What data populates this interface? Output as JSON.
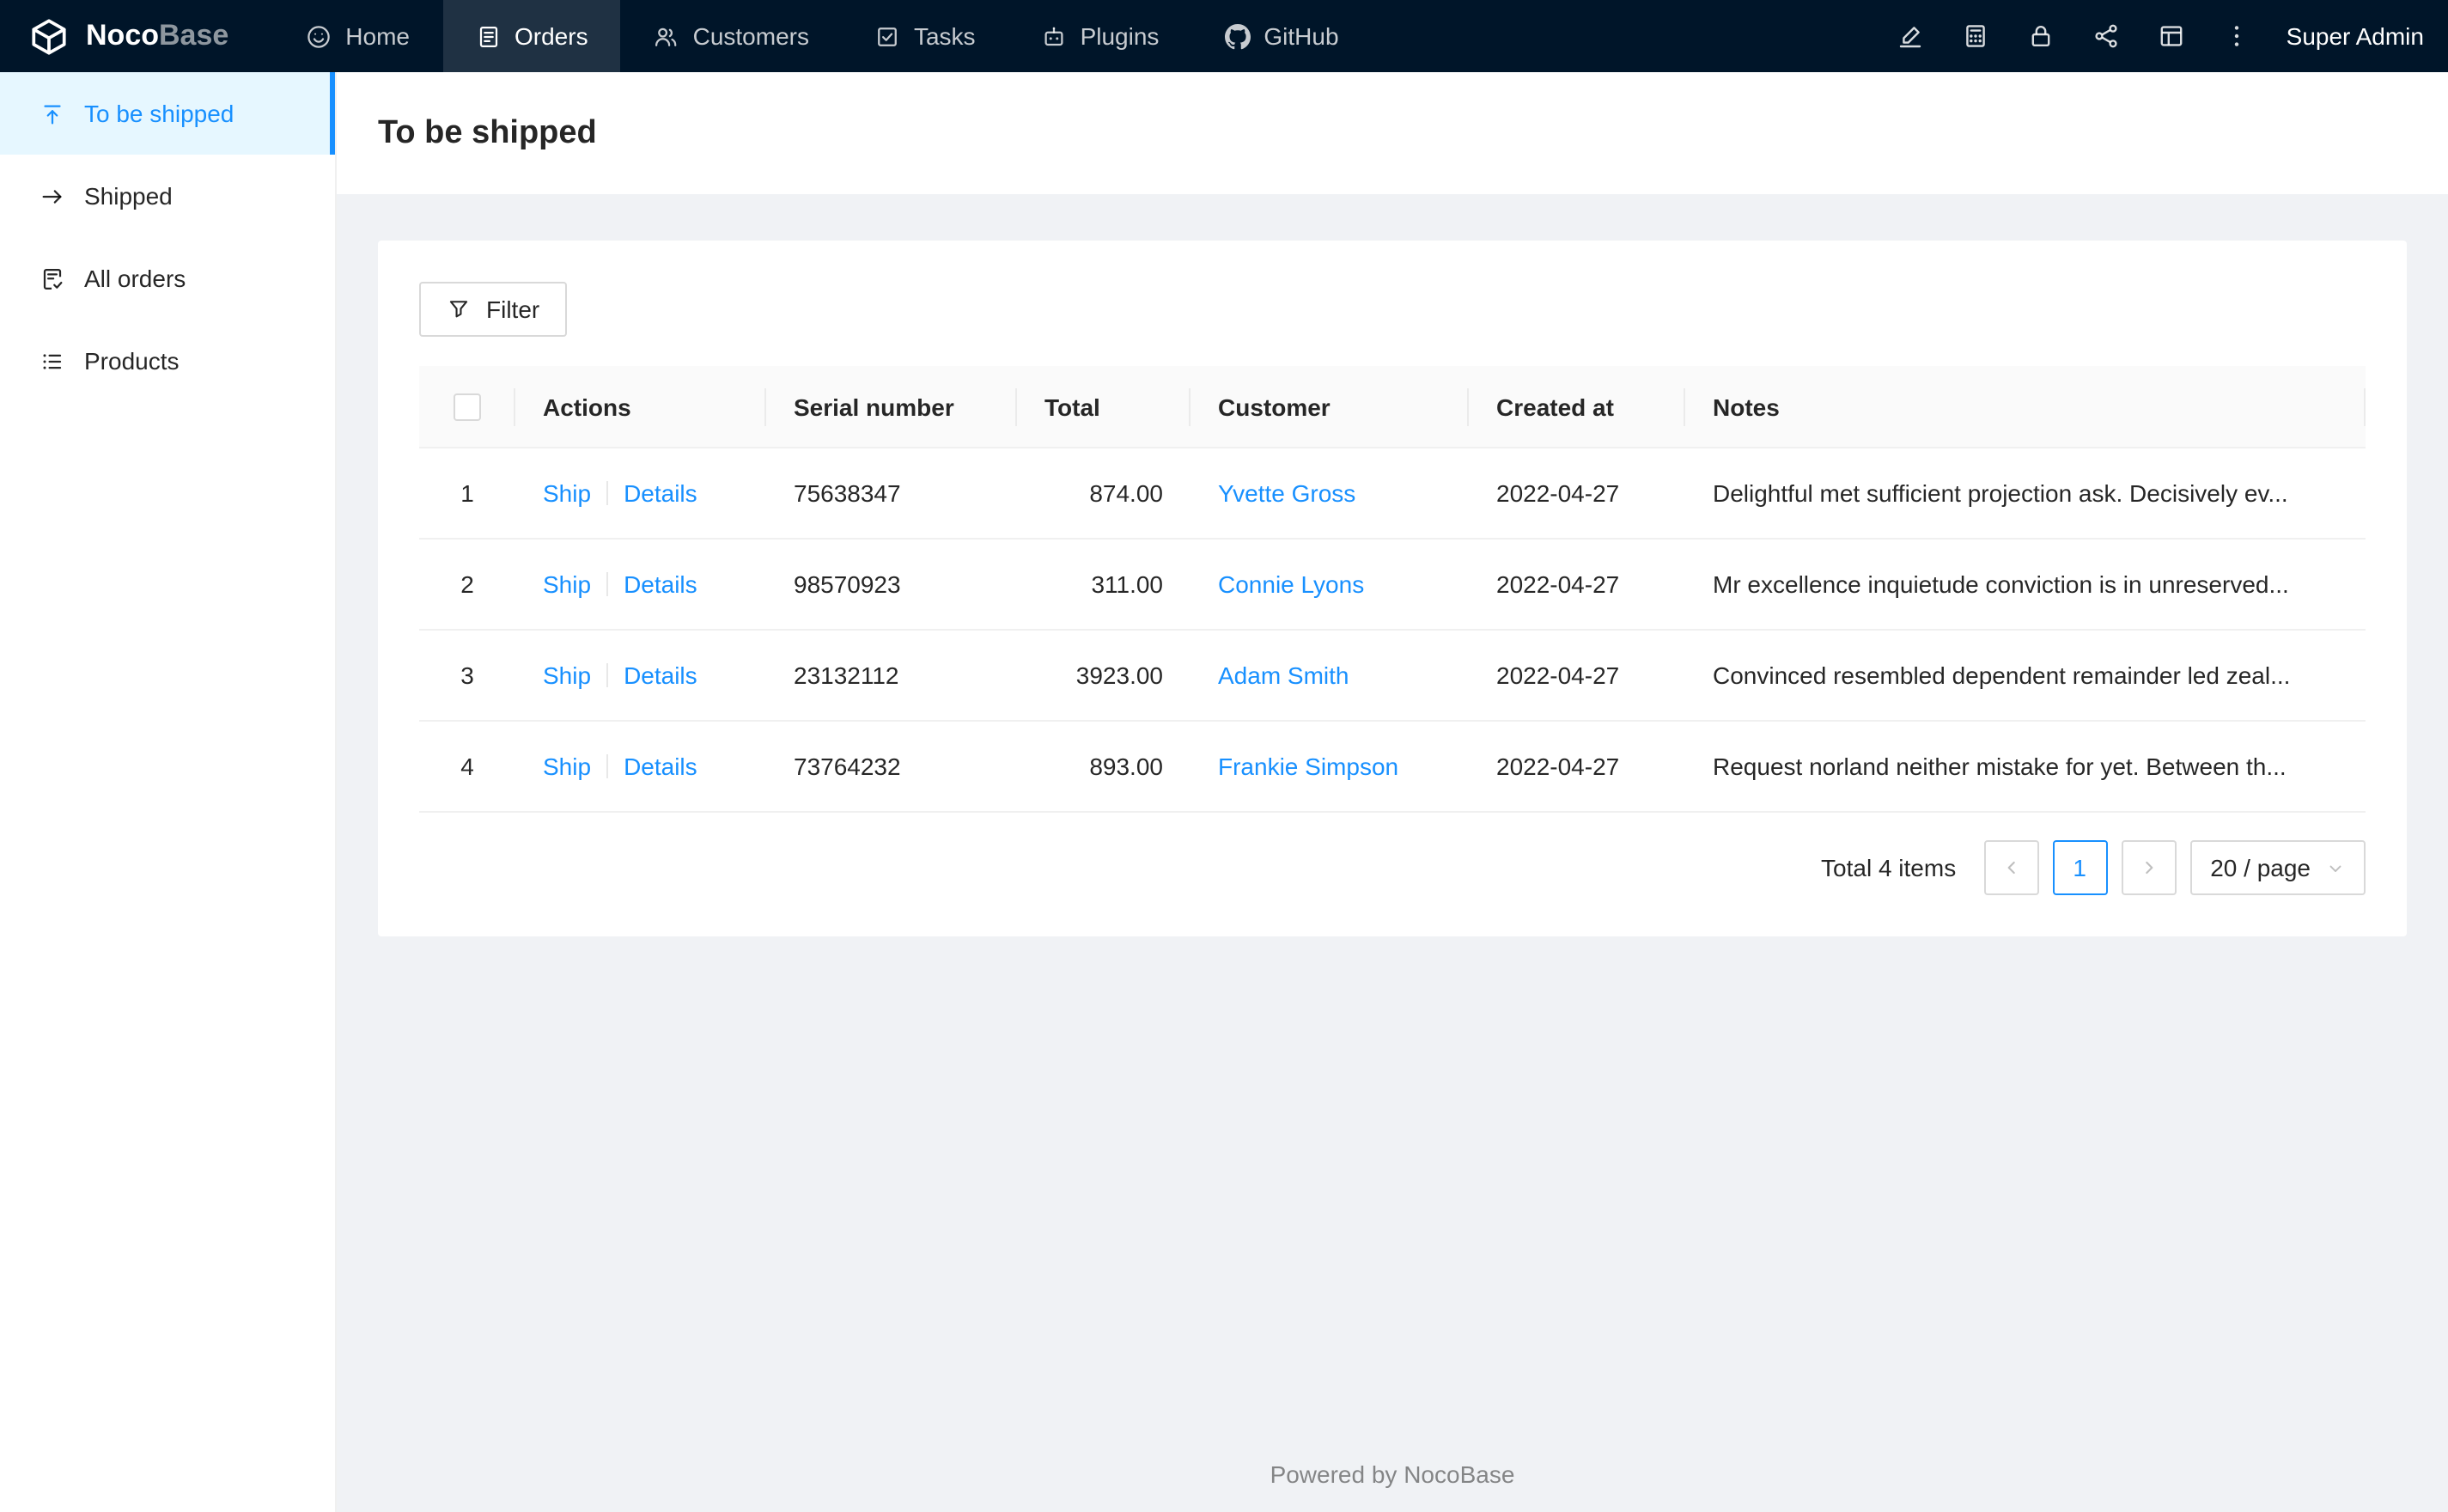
{
  "navbar": {
    "logo_primary": "Noco",
    "logo_secondary": "Base",
    "items": [
      {
        "label": "Home",
        "icon": "home-icon",
        "active": false
      },
      {
        "label": "Orders",
        "icon": "orders-icon",
        "active": true
      },
      {
        "label": "Customers",
        "icon": "customers-icon",
        "active": false
      },
      {
        "label": "Tasks",
        "icon": "tasks-icon",
        "active": false
      },
      {
        "label": "Plugins",
        "icon": "plugins-icon",
        "active": false
      },
      {
        "label": "GitHub",
        "icon": "github-icon",
        "active": false
      }
    ],
    "right_icons": [
      {
        "icon": "highlighter-icon"
      },
      {
        "icon": "calculator-icon"
      },
      {
        "icon": "lock-icon"
      },
      {
        "icon": "share-icon"
      },
      {
        "icon": "layout-icon"
      },
      {
        "icon": "more-icon"
      }
    ],
    "user": "Super Admin"
  },
  "sidebar": {
    "items": [
      {
        "label": "To be shipped",
        "icon": "to-top-icon",
        "active": true
      },
      {
        "label": "Shipped",
        "icon": "arrow-right-icon",
        "active": false
      },
      {
        "label": "All orders",
        "icon": "audit-icon",
        "active": false
      },
      {
        "label": "Products",
        "icon": "list-icon",
        "active": false
      }
    ]
  },
  "page": {
    "title": "To be shipped"
  },
  "toolbar": {
    "filter_label": "Filter"
  },
  "table": {
    "columns": [
      {
        "key": "select",
        "label": ""
      },
      {
        "key": "actions",
        "label": "Actions"
      },
      {
        "key": "serial",
        "label": "Serial number"
      },
      {
        "key": "total",
        "label": "Total"
      },
      {
        "key": "customer",
        "label": "Customer"
      },
      {
        "key": "created",
        "label": "Created at"
      },
      {
        "key": "notes",
        "label": "Notes"
      }
    ],
    "action_labels": [
      "Ship",
      "Details"
    ],
    "rows": [
      {
        "index": "1",
        "serial": "75638347",
        "total": "874.00",
        "customer": "Yvette Gross",
        "created": "2022-04-27",
        "notes": "Delightful met sufficient projection ask. Decisively ev..."
      },
      {
        "index": "2",
        "serial": "98570923",
        "total": "311.00",
        "customer": "Connie Lyons",
        "created": "2022-04-27",
        "notes": "Mr excellence inquietude conviction is in unreserved..."
      },
      {
        "index": "3",
        "serial": "23132112",
        "total": "3923.00",
        "customer": "Adam Smith",
        "created": "2022-04-27",
        "notes": "Convinced resembled dependent remainder led zeal..."
      },
      {
        "index": "4",
        "serial": "73764232",
        "total": "893.00",
        "customer": "Frankie Simpson",
        "created": "2022-04-27",
        "notes": "Request norland neither mistake for yet. Between th..."
      }
    ]
  },
  "pagination": {
    "total_text": "Total 4 items",
    "current_page": "1",
    "page_size_label": "20 / page"
  },
  "footer": {
    "text": "Powered by NocoBase"
  },
  "colors": {
    "primary": "#1890ff",
    "navbar_bg": "#001529",
    "sidebar_active_bg": "#e6f7ff",
    "content_bg": "#f0f2f5",
    "table_header_bg": "#fafafa"
  }
}
